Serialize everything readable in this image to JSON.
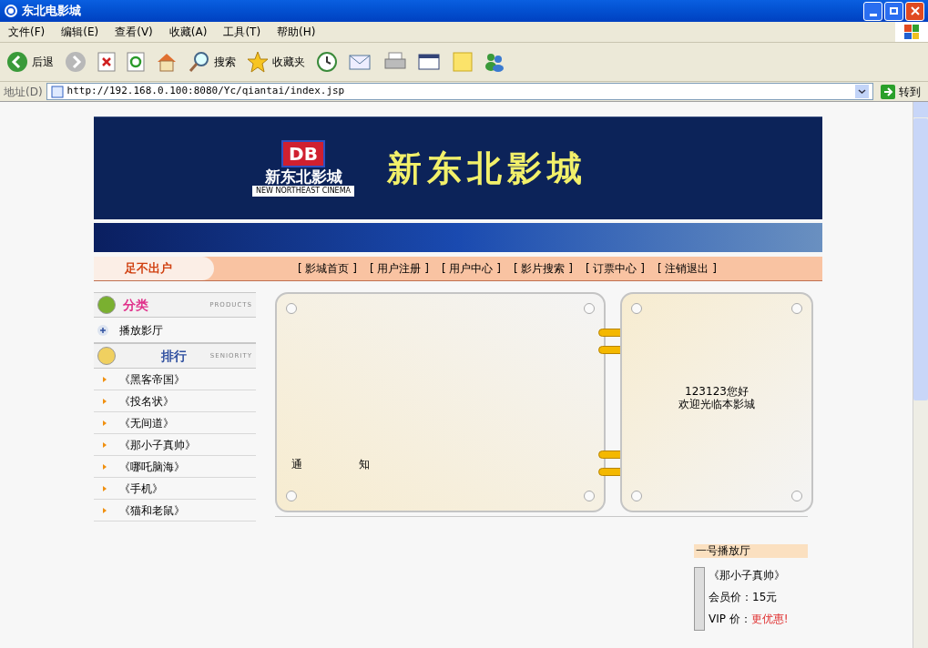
{
  "window": {
    "title": "东北电影城"
  },
  "menu": [
    "文件(F)",
    "编辑(E)",
    "查看(V)",
    "收藏(A)",
    "工具(T)",
    "帮助(H)"
  ],
  "toolbar": [
    {
      "kind": "back",
      "label": "后退"
    },
    {
      "kind": "forward"
    },
    {
      "kind": "stop"
    },
    {
      "kind": "refresh"
    },
    {
      "kind": "home"
    },
    {
      "kind": "search",
      "label": "搜索"
    },
    {
      "kind": "favorites",
      "label": "收藏夹"
    },
    {
      "kind": "history"
    },
    {
      "kind": "mail"
    },
    {
      "kind": "print"
    },
    {
      "kind": "edit"
    },
    {
      "kind": "note"
    },
    {
      "kind": "messenger"
    }
  ],
  "address": {
    "label": "地址(D)",
    "url": "http://192.168.0.100:8080/Yc/qiantai/index.jsp",
    "go": "转到"
  },
  "banner": {
    "logo_mark": "DB",
    "logo_text": "新东北影城",
    "logo_subtitle": "NEW NORTHEAST CINEMA",
    "headline": "新东北影城"
  },
  "nav": {
    "slogan": "足不出户",
    "links": [
      "[ 影城首页 ]",
      "[ 用户注册 ]",
      "[ 用户中心 ]",
      "[ 影片搜索 ]",
      "[ 订票中心 ]",
      "[ 注销退出 ]"
    ]
  },
  "sidebar": {
    "category": {
      "title": "分类",
      "subtitle": "PRODUCTS",
      "items": [
        "播放影厅"
      ]
    },
    "ranking": {
      "title": "排行",
      "subtitle": "SENIORITY",
      "items": [
        "《黑客帝国》",
        "《投名状》",
        "《无间道》",
        "《那小子真帅》",
        "《哪吒脑海》",
        "《手机》",
        "《猫和老鼠》"
      ]
    }
  },
  "notice": {
    "chars": [
      "通",
      "知"
    ]
  },
  "welcome": {
    "lines": [
      "123123您好",
      "欢迎光临本影城"
    ]
  },
  "hall": {
    "title": "一号播放厅",
    "movie": "《那小子真帅》",
    "member_price": "会员价：15元",
    "vip_label": "VIP 价：",
    "vip_price": "更优惠!"
  }
}
